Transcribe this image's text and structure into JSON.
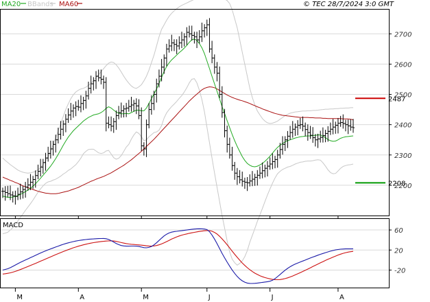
{
  "header": {
    "legend": [
      {
        "label": "MA20",
        "color": "#22aa22"
      },
      {
        "label": "BBands",
        "color": "#c8c8c8"
      },
      {
        "label": "MA60",
        "color": "#aa1111"
      }
    ],
    "timestamp": "© TEC 28/7/2024 3:0 GMT"
  },
  "chart_data": [
    {
      "type": "ohlc",
      "ylim": [
        2100,
        2780
      ],
      "y_ticks": [
        2200,
        2300,
        2400,
        2500,
        2600,
        2700
      ],
      "y_tick_labels": [
        "2200",
        "2300",
        "2400",
        "2500",
        "2600",
        "2700"
      ],
      "x_tick_labels": [
        "M",
        "A",
        "M",
        "J",
        "J",
        "A"
      ],
      "x_tick_index": [
        5,
        30,
        55,
        81,
        106,
        133
      ],
      "x_count": 140,
      "levels": [
        {
          "value": 2487,
          "label": "2487",
          "color": "#cc0000"
        },
        {
          "value": 2208,
          "label": "2208",
          "color": "#009900"
        }
      ],
      "close": [
        2180,
        2176,
        2172,
        2168,
        2165,
        2163,
        2170,
        2178,
        2186,
        2194,
        2201,
        2210,
        2219,
        2232,
        2246,
        2260,
        2275,
        2290,
        2305,
        2320,
        2335,
        2350,
        2368,
        2385,
        2402,
        2418,
        2432,
        2445,
        2455,
        2460,
        2458,
        2470,
        2480,
        2495,
        2520,
        2535,
        2545,
        2560,
        2555,
        2550,
        2540,
        2405,
        2400,
        2395,
        2410,
        2430,
        2440,
        2446,
        2452,
        2455,
        2460,
        2465,
        2470,
        2462,
        2430,
        2330,
        2320,
        2400,
        2450,
        2470,
        2500,
        2535,
        2560,
        2590,
        2620,
        2650,
        2660,
        2670,
        2665,
        2660,
        2670,
        2680,
        2690,
        2705,
        2700,
        2695,
        2690,
        2680,
        2690,
        2710,
        2720,
        2730,
        2650,
        2620,
        2590,
        2570,
        2500,
        2440,
        2380,
        2335,
        2300,
        2265,
        2240,
        2228,
        2218,
        2213,
        2210,
        2208,
        2214,
        2220,
        2226,
        2233,
        2240,
        2248,
        2256,
        2263,
        2270,
        2278,
        2285,
        2300,
        2318,
        2335,
        2350,
        2362,
        2374,
        2385,
        2392,
        2398,
        2400,
        2395,
        2384,
        2374,
        2365,
        2357,
        2350,
        2353,
        2358,
        2364,
        2371,
        2378,
        2385,
        2392,
        2398,
        2405,
        2407,
        2404,
        2400,
        2396,
        2392,
        2390
      ],
      "ma20": [
        2164,
        2162,
        2160,
        2160,
        2161,
        2163,
        2166,
        2170,
        2174,
        2179,
        2184,
        2190,
        2197,
        2205,
        2214,
        2223,
        2233,
        2243,
        2253,
        2263,
        2275,
        2288,
        2302,
        2317,
        2332,
        2346,
        2359,
        2370,
        2380,
        2388,
        2396,
        2404,
        2412,
        2418,
        2424,
        2428,
        2432,
        2434,
        2436,
        2440,
        2446,
        2454,
        2459,
        2455,
        2448,
        2442,
        2438,
        2436,
        2436,
        2437,
        2436,
        2440,
        2444,
        2448,
        2448,
        2446,
        2446,
        2455,
        2470,
        2486,
        2502,
        2518,
        2536,
        2556,
        2576,
        2592,
        2604,
        2614,
        2622,
        2630,
        2638,
        2645,
        2653,
        2662,
        2672,
        2680,
        2683,
        2678,
        2668,
        2654,
        2635,
        2610,
        2585,
        2560,
        2535,
        2510,
        2485,
        2460,
        2437,
        2413,
        2390,
        2368,
        2347,
        2328,
        2311,
        2295,
        2282,
        2272,
        2266,
        2262,
        2261,
        2263,
        2267,
        2272,
        2279,
        2287,
        2296,
        2306,
        2316,
        2325,
        2332,
        2338,
        2343,
        2347,
        2350,
        2353,
        2356,
        2358,
        2360,
        2361,
        2362,
        2363,
        2363,
        2364,
        2365,
        2366,
        2366,
        2362,
        2357,
        2351,
        2347,
        2345,
        2346,
        2350,
        2355,
        2358,
        2360,
        2361,
        2362,
        2363
      ],
      "ma60": [
        2227,
        2223,
        2220,
        2216,
        2213,
        2209,
        2206,
        2202,
        2198,
        2195,
        2192,
        2189,
        2186,
        2183,
        2180,
        2178,
        2176,
        2174,
        2173,
        2172,
        2172,
        2172,
        2173,
        2175,
        2177,
        2179,
        2181,
        2184,
        2187,
        2190,
        2193,
        2197,
        2201,
        2205,
        2209,
        2213,
        2216,
        2220,
        2223,
        2226,
        2229,
        2233,
        2237,
        2241,
        2246,
        2251,
        2256,
        2261,
        2266,
        2272,
        2278,
        2284,
        2291,
        2298,
        2305,
        2312,
        2320,
        2328,
        2336,
        2344,
        2352,
        2361,
        2370,
        2379,
        2388,
        2397,
        2406,
        2415,
        2424,
        2433,
        2442,
        2451,
        2460,
        2469,
        2478,
        2486,
        2494,
        2501,
        2508,
        2515,
        2520,
        2523,
        2525,
        2524,
        2522,
        2518,
        2513,
        2508,
        2503,
        2498,
        2494,
        2490,
        2487,
        2484,
        2481,
        2479,
        2476,
        2473,
        2470,
        2466,
        2463,
        2459,
        2456,
        2452,
        2449,
        2446,
        2443,
        2440,
        2437,
        2435,
        2433,
        2431,
        2430,
        2429,
        2428,
        2427,
        2426,
        2425,
        2424,
        2424,
        2424,
        2424,
        2423,
        2423,
        2422,
        2422,
        2422,
        2421,
        2421,
        2420,
        2420,
        2420,
        2420,
        2420,
        2420,
        2419,
        2419,
        2419,
        2418,
        2416
      ],
      "bb_upper": [
        2290,
        2282,
        2275,
        2268,
        2262,
        2256,
        2250,
        2246,
        2243,
        2241,
        2240,
        2241,
        2243,
        2246,
        2251,
        2258,
        2268,
        2280,
        2295,
        2313,
        2333,
        2356,
        2379,
        2404,
        2427,
        2450,
        2469,
        2486,
        2499,
        2508,
        2514,
        2518,
        2520,
        2524,
        2530,
        2537,
        2545,
        2555,
        2565,
        2575,
        2585,
        2595,
        2603,
        2607,
        2605,
        2598,
        2587,
        2574,
        2560,
        2548,
        2537,
        2528,
        2522,
        2520,
        2525,
        2532,
        2545,
        2560,
        2580,
        2605,
        2630,
        2660,
        2690,
        2715,
        2730,
        2745,
        2758,
        2768,
        2776,
        2783,
        2789,
        2794,
        2798,
        2802,
        2806,
        2810,
        2814,
        2818,
        2822,
        2825,
        2827,
        2829,
        2830,
        2830,
        2829,
        2827,
        2824,
        2820,
        2815,
        2810,
        2800,
        2780,
        2750,
        2720,
        2680,
        2640,
        2600,
        2560,
        2520,
        2490,
        2465,
        2445,
        2432,
        2420,
        2412,
        2406,
        2404,
        2405,
        2408,
        2412,
        2418,
        2424,
        2430,
        2434,
        2438,
        2440,
        2442,
        2443,
        2444,
        2445,
        2445,
        2446,
        2446,
        2447,
        2447,
        2448,
        2449,
        2450,
        2451,
        2451,
        2452,
        2452,
        2453,
        2453,
        2454,
        2454,
        2455,
        2455,
        2456,
        2456
      ],
      "bb_lower": [
        2040,
        2042,
        2045,
        2052,
        2060,
        2070,
        2082,
        2094,
        2105,
        2117,
        2128,
        2139,
        2151,
        2164,
        2177,
        2188,
        2198,
        2206,
        2211,
        2213,
        2217,
        2220,
        2225,
        2230,
        2237,
        2242,
        2249,
        2254,
        2261,
        2268,
        2278,
        2290,
        2304,
        2312,
        2318,
        2319,
        2319,
        2313,
        2307,
        2305,
        2307,
        2313,
        2315,
        2303,
        2291,
        2286,
        2289,
        2298,
        2312,
        2326,
        2335,
        2352,
        2366,
        2376,
        2371,
        2360,
        2347,
        2350,
        2360,
        2367,
        2374,
        2376,
        2382,
        2397,
        2422,
        2439,
        2450,
        2460,
        2468,
        2477,
        2487,
        2496,
        2508,
        2522,
        2538,
        2550,
        2552,
        2538,
        2514,
        2483,
        2443,
        2391,
        2340,
        2290,
        2241,
        2193,
        2146,
        2100,
        2059,
        2016,
        1980,
        1956,
        1944,
        1936,
        1942,
        1950,
        1964,
        1984,
        2012,
        2034,
        2057,
        2081,
        2102,
        2124,
        2146,
        2168,
        2188,
        2207,
        2224,
        2238,
        2246,
        2252,
        2256,
        2260,
        2262,
        2266,
        2270,
        2273,
        2276,
        2277,
        2279,
        2280,
        2280,
        2281,
        2283,
        2284,
        2283,
        2274,
        2263,
        2251,
        2242,
        2238,
        2239,
        2247,
        2256,
        2262,
        2265,
        2267,
        2268,
        2270
      ]
    },
    {
      "type": "line",
      "title": "MACD",
      "ylim": [
        -55,
        82
      ],
      "y_ticks": [
        60,
        20,
        -20
      ],
      "y_tick_labels": [
        "60",
        "20",
        "-20"
      ],
      "series": [
        {
          "color": "#1a1aa8",
          "values": [
            -20.0,
            -18.7,
            -17.3,
            -15.3,
            -12.6,
            -9.9,
            -7.2,
            -4.7,
            -2.3,
            0.2,
            2.4,
            4.7,
            7.0,
            9.4,
            11.8,
            14.0,
            16.2,
            18.3,
            20.3,
            22.2,
            24.1,
            26.0,
            27.8,
            29.6,
            31.3,
            32.9,
            34.3,
            35.6,
            36.8,
            37.9,
            38.8,
            39.6,
            40.3,
            40.9,
            41.4,
            41.8,
            42.2,
            42.5,
            42.8,
            43.0,
            43.1,
            42.6,
            41.1,
            38.7,
            35.9,
            33.1,
            30.8,
            29.0,
            28.1,
            27.8,
            27.8,
            27.9,
            27.9,
            27.7,
            27.0,
            26.0,
            24.7,
            24.5,
            25.3,
            27.1,
            30.3,
            34.5,
            39.1,
            43.8,
            48.1,
            51.6,
            54.0,
            55.7,
            56.8,
            57.4,
            58.0,
            58.6,
            59.2,
            59.9,
            60.6,
            61.3,
            61.9,
            62.3,
            62.4,
            62.3,
            61.8,
            60.7,
            56.5,
            49.9,
            41.8,
            32.7,
            23.0,
            13.4,
            4.4,
            -4.2,
            -12.3,
            -19.8,
            -26.7,
            -32.8,
            -37.7,
            -41.5,
            -44.2,
            -45.9,
            -46.7,
            -46.8,
            -46.5,
            -46.0,
            -45.3,
            -44.6,
            -43.9,
            -43.2,
            -42.3,
            -40.4,
            -37.2,
            -33.1,
            -28.8,
            -24.5,
            -20.4,
            -16.7,
            -13.4,
            -10.5,
            -8.0,
            -5.9,
            -4.0,
            -2.0,
            0.0,
            2.0,
            4.0,
            5.9,
            7.8,
            9.6,
            11.4,
            13.1,
            14.7,
            16.3,
            17.7,
            19.0,
            20.2,
            21.1,
            21.7,
            22.0,
            22.2,
            22.3,
            22.3,
            22.3
          ]
        },
        {
          "color": "#cc1111",
          "values": [
            -28.0,
            -27.3,
            -26.5,
            -25.5,
            -24.2,
            -22.6,
            -20.9,
            -19.0,
            -17.0,
            -14.9,
            -12.8,
            -10.8,
            -8.7,
            -6.6,
            -4.5,
            -2.3,
            -0.2,
            2.0,
            4.2,
            6.4,
            8.5,
            10.7,
            12.8,
            14.9,
            16.9,
            18.9,
            20.8,
            22.6,
            24.4,
            26.0,
            27.6,
            29.0,
            30.4,
            31.6,
            32.8,
            33.8,
            34.7,
            35.5,
            36.2,
            36.9,
            37.4,
            37.9,
            38.2,
            38.3,
            38.0,
            37.2,
            36.1,
            34.9,
            33.8,
            32.8,
            32.0,
            31.4,
            31.0,
            30.6,
            30.2,
            29.7,
            29.1,
            28.5,
            28.0,
            27.9,
            28.2,
            29.0,
            30.3,
            32.1,
            34.3,
            36.8,
            39.3,
            41.8,
            44.1,
            46.2,
            48.0,
            49.6,
            51.0,
            52.2,
            53.3,
            54.3,
            55.3,
            56.2,
            57.0,
            57.8,
            58.4,
            58.9,
            58.7,
            57.5,
            55.2,
            51.8,
            47.4,
            42.3,
            36.6,
            30.5,
            24.2,
            17.8,
            11.5,
            5.4,
            -0.4,
            -5.8,
            -10.8,
            -15.3,
            -19.4,
            -23.0,
            -26.2,
            -28.9,
            -31.3,
            -33.3,
            -35.0,
            -36.4,
            -37.6,
            -38.5,
            -39.1,
            -39.3,
            -39.0,
            -38.2,
            -37.0,
            -35.5,
            -33.7,
            -31.8,
            -29.7,
            -27.5,
            -25.2,
            -22.8,
            -20.4,
            -18.0,
            -15.5,
            -13.0,
            -10.5,
            -8.1,
            -5.6,
            -3.2,
            -0.8,
            1.5,
            3.7,
            5.8,
            7.9,
            9.9,
            11.7,
            13.3,
            14.7,
            15.8,
            16.7,
            17.4
          ]
        }
      ]
    }
  ]
}
